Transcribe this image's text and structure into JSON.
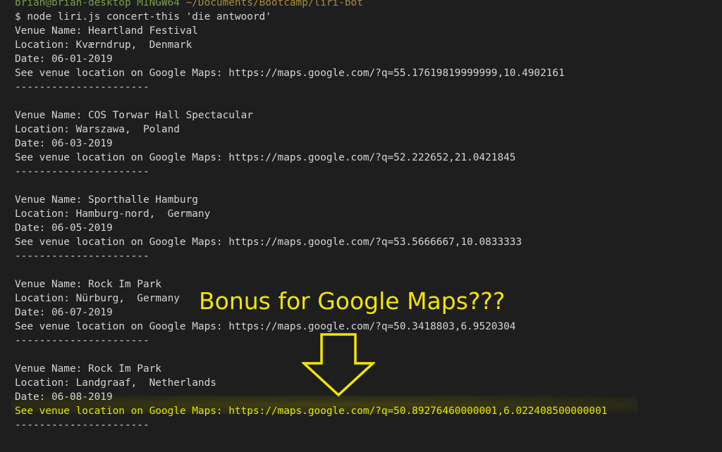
{
  "terminal": {
    "prompt_partial": {
      "user_host": "brian@brian-desktop MINGW64",
      "path": "~/Documents/Bootcamp/liri-bot"
    },
    "command_line": "$ node liri.js concert-this 'die antwoord'",
    "events": [
      {
        "venue": "Venue Name: Heartland Festival",
        "location": "Location: Kværndrup,  Denmark",
        "date": "Date: 06-01-2019",
        "maps": "See venue location on Google Maps: https://maps.google.com/?q=55.17619819999999,10.4902161",
        "separator": "----------------------"
      },
      {
        "venue": "Venue Name: COS Torwar Hall Spectacular",
        "location": "Location: Warszawa,  Poland",
        "date": "Date: 06-03-2019",
        "maps": "See venue location on Google Maps: https://maps.google.com/?q=52.222652,21.0421845",
        "separator": "----------------------"
      },
      {
        "venue": "Venue Name: Sporthalle Hamburg",
        "location": "Location: Hamburg-nord,  Germany",
        "date": "Date: 06-05-2019",
        "maps": "See venue location on Google Maps: https://maps.google.com/?q=53.5666667,10.0833333",
        "separator": "----------------------"
      },
      {
        "venue": "Venue Name: Rock Im Park",
        "location": "Location: Nürburg,  Germany",
        "date": "Date: 06-07-2019",
        "maps": "See venue location on Google Maps: https://maps.google.com/?q=50.3418803,6.9520304",
        "separator": "----------------------"
      },
      {
        "venue": "Venue Name: Rock Im Park",
        "location": "Location: Landgraaf,  Netherlands",
        "date": "Date: 06-08-2019",
        "maps": "See venue location on Google Maps: https://maps.google.com/?q=50.89276460000001,6.022408500000001",
        "separator": "----------------------"
      }
    ]
  },
  "annotation": {
    "text": "Bonus for Google Maps???",
    "color": "#f2e600",
    "arrow_icon": "down-arrow-outline-icon"
  },
  "colors": {
    "background": "#1e1e1e",
    "text": "#d4d4d4",
    "highlight": "#e6e600"
  }
}
